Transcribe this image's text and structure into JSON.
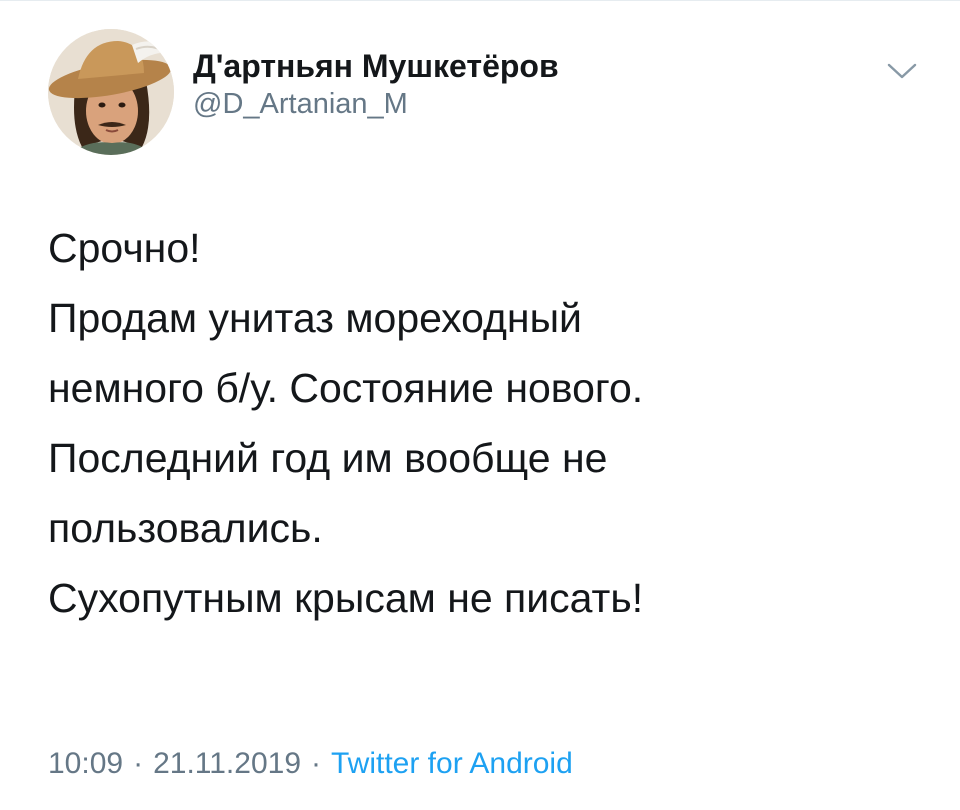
{
  "tweet": {
    "author": {
      "display_name": "Д'артньян Мушкетёров",
      "handle": "@D_Artanian_M",
      "avatar_icon": "user-avatar-musketeer-hat"
    },
    "menu_icon": "chevron-down-icon",
    "text_lines": [
      "Срочно!",
      "Продам унитаз мореходный",
      "немного б/у. Состояние нового.",
      "Последний год им вообще не",
      "пользовались.",
      "Сухопутным крысам не писать!"
    ],
    "time": "10:09",
    "date": "21.11.2019",
    "separator": "·",
    "source": "Twitter for Android"
  },
  "colors": {
    "text": "#14171a",
    "secondary": "#657786",
    "link": "#1da1f2",
    "chevron": "#8899a6"
  }
}
